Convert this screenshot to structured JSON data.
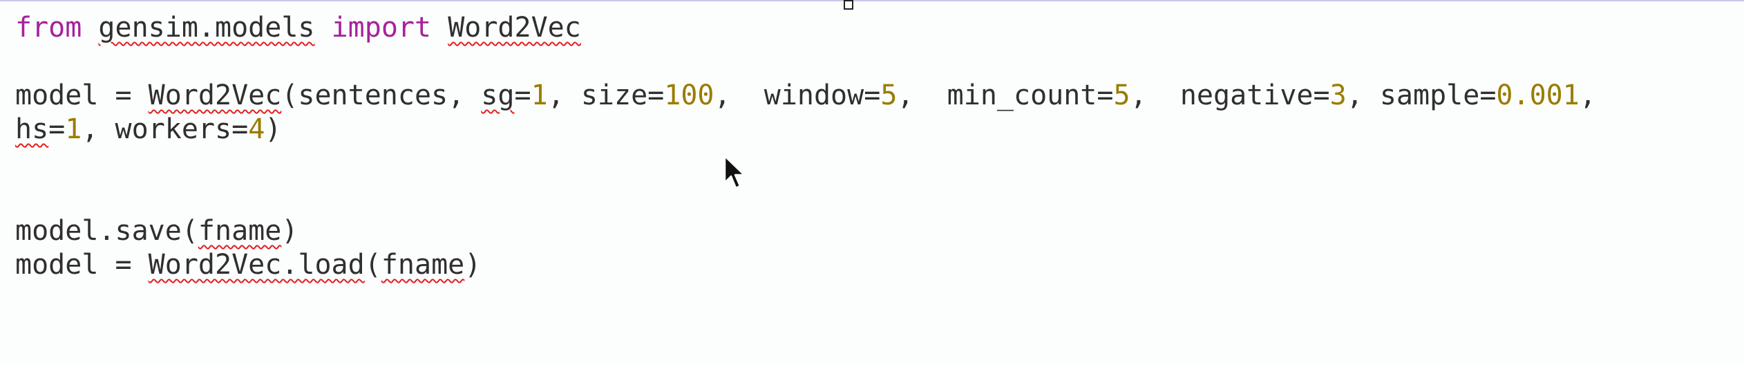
{
  "editor": {
    "lines": [
      {
        "tokens": [
          {
            "t": "from",
            "c": "kw"
          },
          {
            "t": " "
          },
          {
            "t": "gensim.models",
            "c": "err"
          },
          {
            "t": " "
          },
          {
            "t": "import",
            "c": "kw"
          },
          {
            "t": " "
          },
          {
            "t": "Word2Vec",
            "c": "err"
          }
        ]
      },
      {
        "blank": true
      },
      {
        "tokens": [
          {
            "t": "model = "
          },
          {
            "t": "Word2Vec",
            "c": "err"
          },
          {
            "t": "(sentences, "
          },
          {
            "t": "sg",
            "c": "err"
          },
          {
            "t": "="
          },
          {
            "t": "1",
            "c": "num"
          },
          {
            "t": ", size="
          },
          {
            "t": "100",
            "c": "num"
          },
          {
            "t": ",  window="
          },
          {
            "t": "5",
            "c": "num"
          },
          {
            "t": ",  min_count="
          },
          {
            "t": "5",
            "c": "num"
          },
          {
            "t": ",  negative="
          },
          {
            "t": "3",
            "c": "num"
          },
          {
            "t": ", sample="
          },
          {
            "t": "0.001",
            "c": "num"
          },
          {
            "t": ","
          }
        ]
      },
      {
        "tokens": [
          {
            "t": "hs",
            "c": "err"
          },
          {
            "t": "="
          },
          {
            "t": "1",
            "c": "num"
          },
          {
            "t": ", workers="
          },
          {
            "t": "4",
            "c": "num"
          },
          {
            "t": ")"
          }
        ]
      },
      {
        "blank": true
      },
      {
        "blank": true
      },
      {
        "tokens": [
          {
            "t": "model.save("
          },
          {
            "t": "fname",
            "c": "err"
          },
          {
            "t": ")"
          }
        ]
      },
      {
        "tokens": [
          {
            "t": "model = "
          },
          {
            "t": "Word2Vec.load",
            "c": "err"
          },
          {
            "t": "("
          },
          {
            "t": "fname",
            "c": "err"
          },
          {
            "t": ")"
          }
        ]
      }
    ]
  },
  "icons": {
    "cursor": "mouse-pointer-icon",
    "selection_handle": "resize-handle-icon"
  },
  "colors": {
    "keyword": "#a5229b",
    "number": "#9a7c00",
    "text": "#2f2f2f",
    "spellcheck_underline": "#e02020",
    "background": "#fcfdfd"
  }
}
